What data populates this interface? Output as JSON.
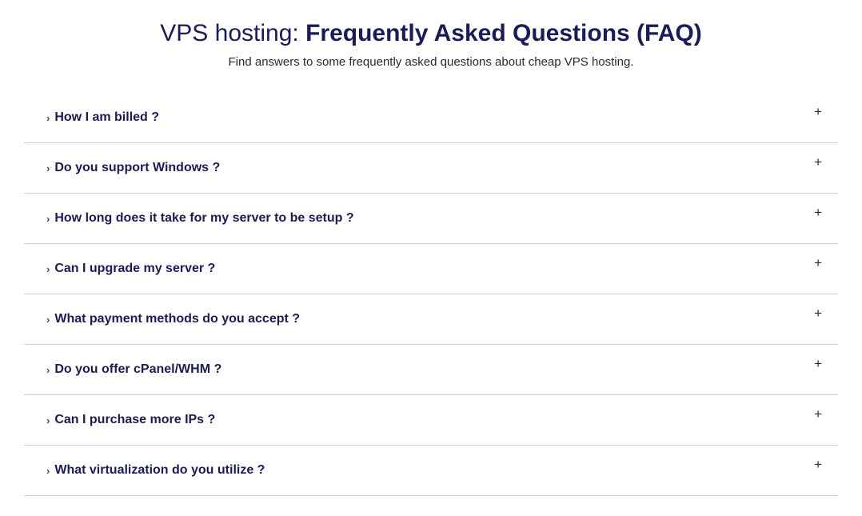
{
  "header": {
    "title_light": "VPS hosting: ",
    "title_bold": "Frequently Asked Questions (FAQ)",
    "subtitle": "Find answers to some frequently asked questions about cheap VPS hosting."
  },
  "faq": {
    "items": [
      {
        "question": "How I am billed ?"
      },
      {
        "question": "Do you support Windows ?"
      },
      {
        "question": "How long does it take for my server to be setup ?"
      },
      {
        "question": "Can I upgrade my server ?"
      },
      {
        "question": "What payment methods do you accept ?"
      },
      {
        "question": "Do you offer cPanel/WHM ?"
      },
      {
        "question": "Can I purchase more IPs ?"
      },
      {
        "question": "What virtualization do you utilize ?"
      }
    ]
  },
  "icons": {
    "chevron": "›",
    "expand": "+"
  }
}
